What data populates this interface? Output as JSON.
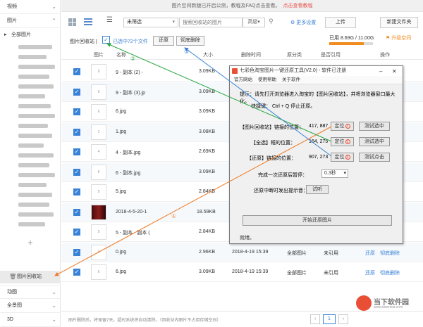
{
  "notice": {
    "text": "图片空间新版已开启公测，教程及FAQ点击查看。",
    "link": "点击查看教程"
  },
  "sidebar": {
    "top_items": [
      {
        "label": "视频"
      },
      {
        "label": "图片"
      }
    ],
    "all_images": "全部图片",
    "plus": "+",
    "recycle": "图片回收站",
    "bottom_items": [
      {
        "label": "动图"
      },
      {
        "label": "全景图"
      },
      {
        "label": "3D"
      }
    ]
  },
  "toolbar": {
    "filter_value": "未筛选",
    "search_placeholder": "搜索回收站的图片",
    "advanced": "高级",
    "settings": "更多设置",
    "upload": "上传",
    "new_folder": "新建文件夹"
  },
  "recycle_bar": {
    "title": "图片回收站",
    "separator": "|",
    "selected_text": "已选中72个文件",
    "restore": "还原",
    "delete_all": "彻底删除",
    "storage_text": "已用 8.69G / 11.00G",
    "storage_fraction": 0.79,
    "upgrade": "升级空间"
  },
  "table": {
    "headers": {
      "image": "图片",
      "name": "名称",
      "size": "大小",
      "deleted_time": "删除时间",
      "category": "原分类",
      "ref": "是否引用",
      "actions": "操作"
    },
    "rows": [
      {
        "name": "9 - 副本 (2) -",
        "size": "3.09KB",
        "date": "",
        "category": "",
        "ref": "",
        "a1": "",
        "a2": "",
        "thumb": "9"
      },
      {
        "name": "9 - 副本 (3).jp",
        "size": "3.09KB",
        "date": "",
        "category": "",
        "ref": "",
        "a1": "",
        "a2": "",
        "thumb": "9"
      },
      {
        "name": "6.jpg",
        "size": "3.09KB",
        "date": "",
        "category": "",
        "ref": "",
        "a1": "",
        "a2": "",
        "thumb": "6"
      },
      {
        "name": "1.jpg",
        "size": "3.08KB",
        "date": "",
        "category": "",
        "ref": "",
        "a1": "",
        "a2": "",
        "thumb": "1"
      },
      {
        "name": "4 - 副本.jpg",
        "size": "2.69KB",
        "date": "",
        "category": "",
        "ref": "",
        "a1": "",
        "a2": "",
        "thumb": "4"
      },
      {
        "name": "6 - 副本.jpg",
        "size": "3.09KB",
        "date": "",
        "category": "",
        "ref": "",
        "a1": "",
        "a2": "",
        "thumb": "6"
      },
      {
        "name": "5.jpg",
        "size": "2.84KB",
        "date": "",
        "category": "",
        "ref": "",
        "a1": "",
        "a2": "",
        "thumb": "5"
      },
      {
        "name": "2018-4-5-20-1",
        "size": "18.59KB",
        "date": "",
        "category": "",
        "ref": "",
        "a1": "",
        "a2": "",
        "thumb": ""
      },
      {
        "name": "5 - 副本 - 副本 (",
        "size": "2.84KB",
        "date": "2018-4-19 15:39",
        "category": "全部图片",
        "ref": "未引用",
        "a1": "还原",
        "a2": "彻底删除",
        "thumb": "5"
      },
      {
        "name": "0.jpg",
        "size": "2.96KB",
        "date": "2018-4-19 15:39",
        "category": "全部图片",
        "ref": "未引用",
        "a1": "还原",
        "a2": "彻底删除",
        "thumb": "0"
      },
      {
        "name": "6.jpg",
        "size": "3.09KB",
        "date": "2018-4-19 15:39",
        "category": "全部图片",
        "ref": "未引用",
        "a1": "还原",
        "a2": "彻底删除",
        "thumb": "6"
      }
    ]
  },
  "footer": {
    "note": "图片删除后，将保留7天，超时系统将自动清除。（回收站内图片不占用存储空间）",
    "prev": "‹",
    "page": "1",
    "next": "›"
  },
  "tool": {
    "title": "七彩色淘宝图片一键还原工具(V2.0) - 软件已注册",
    "menu": [
      "官方网站",
      "使用帮助",
      "关于软件"
    ],
    "hint": "提示：请先打开浏览器进入淘宝的【图片回收站】，并将浏览器窗口最大化。",
    "hotkey": "快捷键：  Ctrl + Q  停止还原。",
    "rows": [
      {
        "label": "【图片回收站】链接的位置：",
        "value": "417, 887",
        "locate": "定位",
        "num": "1",
        "test": "测试选中"
      },
      {
        "label": "【全选】框的位置：",
        "value": "164, 275",
        "locate": "定位",
        "num": "2",
        "test": "测试选中"
      },
      {
        "label": "【还原】链接的位置：",
        "value": "907, 273",
        "locate": "定位",
        "num": "3",
        "test": "测试点击"
      }
    ],
    "wait_label": "完成一次还原后暂停：",
    "wait_value": "0.3秒",
    "sound_label": "还原中断时发出提示音：",
    "audition": "试听",
    "start": "开始还原图片",
    "status": "就绪。"
  },
  "annotations": [
    "①",
    "②",
    "③"
  ],
  "watermark": {
    "text": "当下软件园",
    "url": "www.downxia.com"
  },
  "colors": {
    "accent": "#3a82d8",
    "arrow_orange": "#f07820",
    "arrow_green": "#2aa843",
    "arrow_blue": "#3a82d8"
  }
}
